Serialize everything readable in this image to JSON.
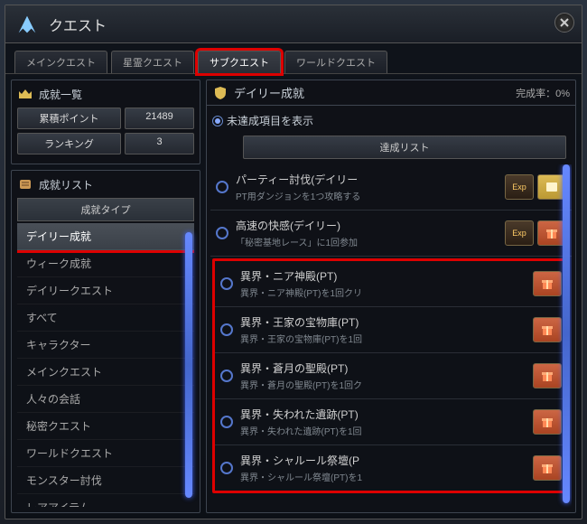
{
  "window": {
    "title": "クエスト"
  },
  "tabs": [
    {
      "label": "メインクエスト"
    },
    {
      "label": "星霊クエスト"
    },
    {
      "label": "サブクエスト"
    },
    {
      "label": "ワールドクエスト"
    }
  ],
  "summary": {
    "header": "成就一覧",
    "points_label": "累積ポイント",
    "points_value": "21489",
    "ranking_label": "ランキング",
    "ranking_value": "3"
  },
  "achievement_list": {
    "header": "成就リスト",
    "type_header": "成就タイプ",
    "items": [
      "デイリー成就",
      "ウィーク成就",
      "デイリークエスト",
      "すべて",
      "キャラクター",
      "メインクエスト",
      "人々の会話",
      "秘密クエスト",
      "ワールドクエスト",
      "モンスター討伐",
      "レアアイテム"
    ]
  },
  "right": {
    "title": "デイリー成就",
    "completion_label": "完成率：0%",
    "filter_label": "未達成項目を表示",
    "list_button": "達成リスト",
    "quests": [
      {
        "title": "パーティー討伐(デイリー",
        "desc": "PT用ダンジョンを1つ攻略する",
        "rewards": [
          "exp",
          "scroll"
        ]
      },
      {
        "title": "高速の快感(デイリー)",
        "desc": "「秘密基地レース」に1回参加",
        "rewards": [
          "exp",
          "gift"
        ]
      },
      {
        "title": "異界・ニア神殿(PT)",
        "desc": "異界・ニア神殿(PT)を1回クリ",
        "rewards": [
          "gift"
        ]
      },
      {
        "title": "異界・王家の宝物庫(PT)",
        "desc": "異界・王家の宝物庫(PT)を1回",
        "rewards": [
          "gift"
        ]
      },
      {
        "title": "異界・蒼月の聖殿(PT)",
        "desc": "異界・蒼月の聖殿(PT)を1回ク",
        "rewards": [
          "gift"
        ]
      },
      {
        "title": "異界・失われた遺跡(PT)",
        "desc": "異界・失われた遺跡(PT)を1回",
        "rewards": [
          "gift"
        ]
      },
      {
        "title": "異界・シャルール祭壇(P",
        "desc": "異界・シャルール祭壇(PT)を1",
        "rewards": [
          "gift"
        ]
      }
    ]
  }
}
